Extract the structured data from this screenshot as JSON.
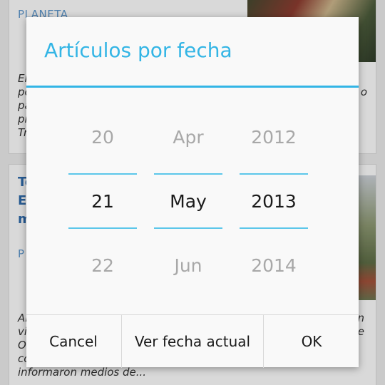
{
  "feed": {
    "card1": {
      "section": "PLANETA",
      "excerpt_lines": [
        "El",
        "po",
        "pa",
        "pr",
        "Tr"
      ],
      "excerpt_right": "o"
    },
    "card2": {
      "title_lines": [
        "To",
        "E",
        "m"
      ],
      "section": "P",
      "excerpt_lines": [
        "Al",
        "vi",
        "O",
        "co",
        "informaron medios de..."
      ],
      "excerpt_right": [
        "n",
        "e"
      ]
    }
  },
  "dialog": {
    "title": "Artículos por fecha",
    "day": {
      "prev": "20",
      "current": "21",
      "next": "22"
    },
    "month": {
      "prev": "Apr",
      "current": "May",
      "next": "Jun"
    },
    "year": {
      "prev": "2012",
      "current": "2013",
      "next": "2014"
    },
    "buttons": {
      "cancel": "Cancel",
      "today": "Ver fecha actual",
      "ok": "OK"
    }
  },
  "colors": {
    "accent": "#33b5e5",
    "selector_line": "#5cc7ea",
    "link": "#2d68a8"
  }
}
